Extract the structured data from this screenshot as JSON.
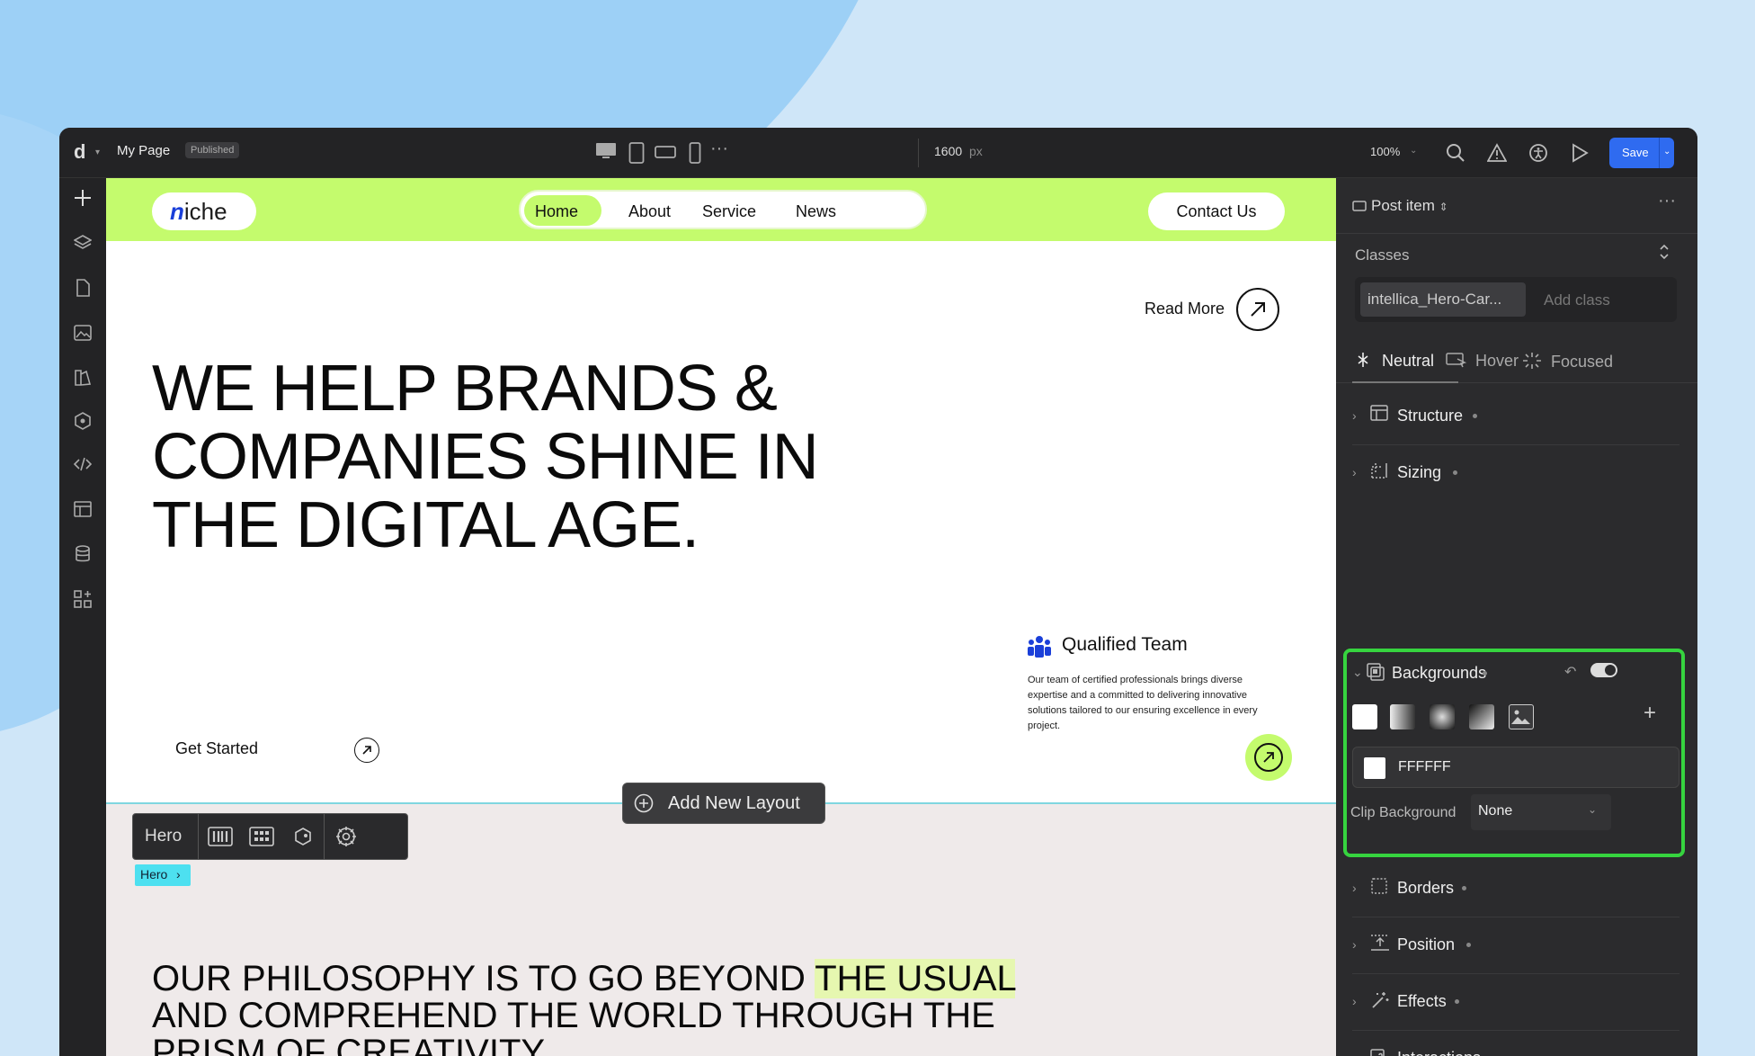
{
  "topbar": {
    "logo": "d",
    "page_title": "My Page",
    "status_badge": "Published",
    "canvas_width": "1600",
    "canvas_unit": "px",
    "zoom": "100%",
    "save_label": "Save"
  },
  "site": {
    "logo_n": "n",
    "logo_rest": "iche",
    "nav": [
      "Home",
      "About",
      "Service",
      "News"
    ],
    "contact_label": "Contact Us",
    "read_more": "Read More",
    "hero_title": "WE HELP BRANDS & COMPANIES SHINE IN THE DIGITAL AGE.",
    "qualified_title": "Qualified Team",
    "qualified_text": "Our team of certified professionals brings diverse expertise and a committed to delivering innovative solutions tailored to our ensuring excellence in every project.",
    "get_started": "Get Started",
    "philosophy_a": "OUR PHILOSOPHY IS TO GO BEYOND ",
    "philosophy_hl": "THE USUAL",
    "philosophy_b": " AND COMPREHEND THE WORLD THROUGH THE PRISM OF CREATIVITY."
  },
  "canvas_tools": {
    "add_layout": "Add New Layout",
    "section_label": "Hero",
    "section_tag": "Hero"
  },
  "panel": {
    "header": "Post item",
    "classes_label": "Classes",
    "class_chip": "intellica_Hero-Car...",
    "add_class_placeholder": "Add class",
    "states": [
      "Neutral",
      "Hover",
      "Focused"
    ],
    "sections": {
      "structure": "Structure",
      "sizing": "Sizing",
      "backgrounds": "Backgrounds",
      "borders": "Borders",
      "position": "Position",
      "effects": "Effects",
      "interactions": "Interactions"
    },
    "bg_color": "FFFFFF",
    "clip_label": "Clip Background",
    "clip_value": "None"
  },
  "colors": {
    "accent_green": "#c4fb6d",
    "save_blue": "#2f6bf0",
    "highlight_border": "#36d43f",
    "logo_blue": "#1a3fd9"
  }
}
